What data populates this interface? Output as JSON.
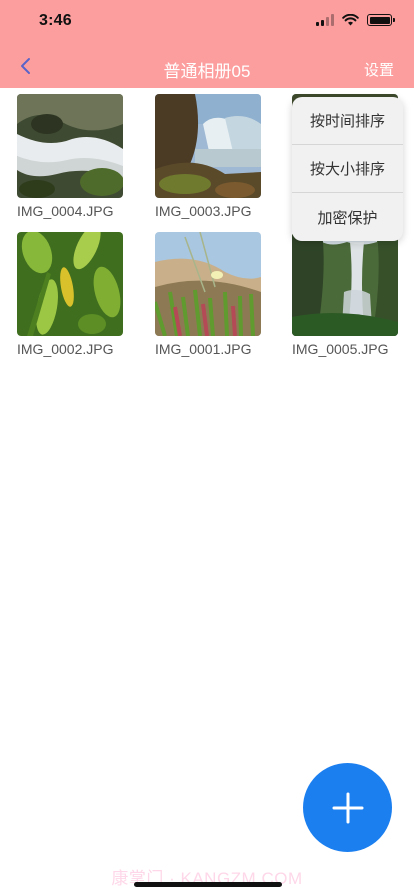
{
  "status_bar": {
    "time": "3:46"
  },
  "nav": {
    "title": "普通相册05",
    "settings_label": "设置"
  },
  "photos": [
    {
      "name": "IMG_0004.JPG"
    },
    {
      "name": "IMG_0003.JPG"
    },
    {
      "name": ""
    },
    {
      "name": "IMG_0002.JPG"
    },
    {
      "name": "IMG_0001.JPG"
    },
    {
      "name": "IMG_0005.JPG"
    }
  ],
  "menu": {
    "items": [
      {
        "label": "按时间排序"
      },
      {
        "label": "按大小排序"
      },
      {
        "label": "加密保护"
      }
    ]
  },
  "fab": {
    "icon": "plus-icon"
  },
  "watermark": {
    "text": "康掌门 · KANGZM.COM"
  },
  "colors": {
    "header": "#fd9e9e",
    "fab": "#1b7ff0"
  }
}
